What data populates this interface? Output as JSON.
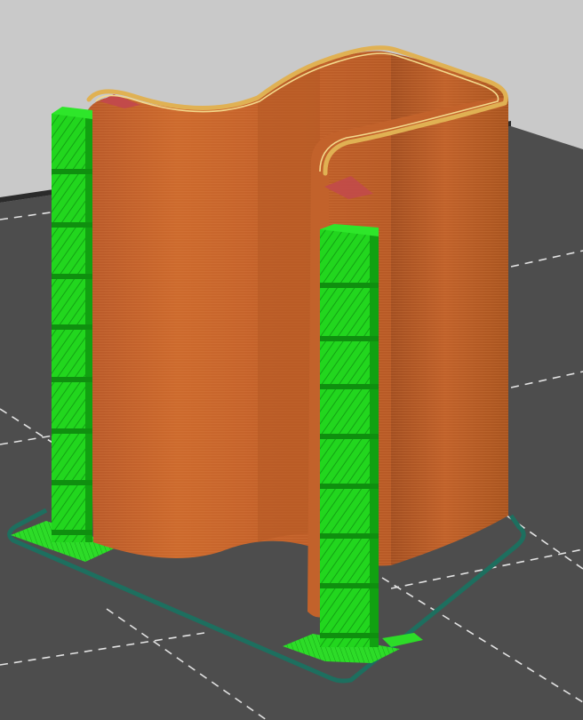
{
  "viewport": {
    "background_light": "#c9c9c9",
    "background_dark": "#3a3a3a",
    "bed_color": "#4f4f4f",
    "grid_line_color": "#f2f2f2"
  },
  "colors": {
    "outer_wall": "#c8662a",
    "outer_wall_shadow": "#a95424",
    "outer_wall_highlight": "#d77a3a",
    "top_edge": "#e2b454",
    "top_edge_inner": "#f0d58a",
    "inner_wall": "#b05a25",
    "support": "#22d61e",
    "support_dark": "#12a012",
    "support_base": "#2fe02a",
    "skirt": "#1d6f5f",
    "overhang": "#c24a4a"
  },
  "objects": {
    "print_model": "curved-wall",
    "supports": [
      "left-support-tower",
      "right-support-tower"
    ],
    "skirt": "skirt-outline"
  }
}
